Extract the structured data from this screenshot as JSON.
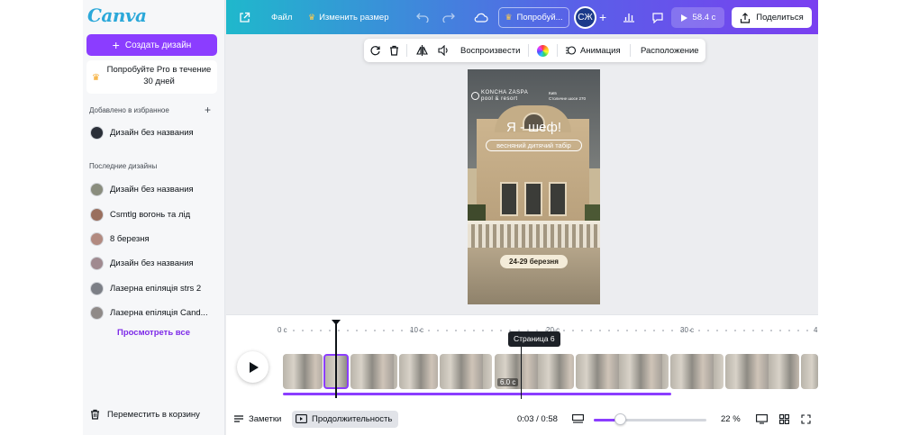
{
  "app": {
    "logo": "Canva"
  },
  "sidebar": {
    "create_label": "Создать дизайн",
    "pro_label": "Попробуйте Pro в течение 30 дней",
    "favorites_title": "Добавлено в избранное",
    "favorites": [
      {
        "label": "Дизайн без названия"
      }
    ],
    "recent_title": "Последние дизайны",
    "recent": [
      {
        "label": "Дизайн без названия"
      },
      {
        "label": "Csmtlg вогонь та лід"
      },
      {
        "label": "8 березня"
      },
      {
        "label": "Дизайн без названия"
      },
      {
        "label": "Лазерна епіляція strs 2"
      },
      {
        "label": "Лазерна епіляція Cand..."
      }
    ],
    "see_all": "Просмотреть все",
    "trash": "Переместить в корзину"
  },
  "topbar": {
    "file": "Файл",
    "resize": "Изменить размер",
    "try_pro": "Попробуй...",
    "avatar_initials": "СЖ",
    "play_duration": "58.4 с",
    "share": "Поделиться"
  },
  "floating_toolbar": {
    "play": "Воспроизвести",
    "animation": "Анимация",
    "position": "Расположение"
  },
  "page": {
    "brand": "KONCHA ZASPA",
    "brand_sub": "pool & resort",
    "location_line1": "Київ",
    "location_line2": "Столичне шосе 270",
    "title": "Я - шеф!",
    "subtitle": "весняний дитячий табір",
    "dates": "24-29 березня"
  },
  "timeline": {
    "ruler": [
      "0 с",
      "10 с",
      "20 с",
      "30 с",
      "4"
    ],
    "tooltip": "Страница 6",
    "clip_duration": "6.0 с",
    "progress_fraction": 0.73
  },
  "bottombar": {
    "notes": "Заметки",
    "duration": "Продолжительность",
    "time": "0:03 / 0:58",
    "zoom": "22 %"
  },
  "colors": {
    "accent": "#8b3dff",
    "topbar_start": "#1fb8cc",
    "topbar_end": "#7a3ff0"
  }
}
